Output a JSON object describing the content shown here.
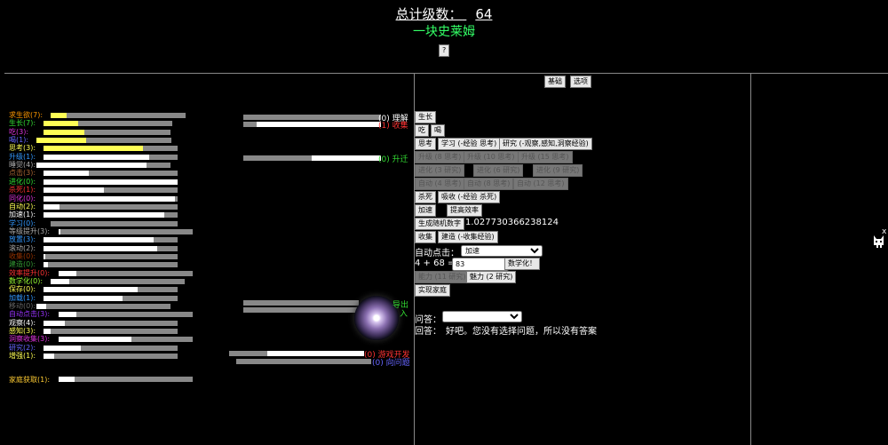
{
  "header": {
    "total_label": "总计级数：",
    "total_value": "64",
    "creature_name": "一块史莱姆",
    "help_label": "?"
  },
  "colors": {
    "yellow": "#ffff55",
    "white": "#ffffff",
    "gray": "#888888"
  },
  "stats": [
    {
      "label": "求生欲(7):",
      "color": "#ff9900",
      "progress": 0.12,
      "fill": "#ffff55"
    },
    {
      "label": "生长(7):",
      "color": "#33dd33",
      "progress": 0.27,
      "fill": "#ffff55"
    },
    {
      "label": "吃(3):",
      "color": "#dd33dd",
      "progress": 0.32,
      "fill": "#ffff55"
    },
    {
      "label": "喝(1):",
      "color": "#6666ff",
      "progress": 0.37,
      "fill": "#ffff55"
    },
    {
      "label": "思考(3):",
      "color": "#ffff55",
      "progress": 0.74,
      "fill": "#ffff55"
    },
    {
      "label": "升级(1):",
      "color": "#3399ff",
      "progress": 0.79,
      "fill": "#ffffff"
    },
    {
      "label": "睡觉(4):",
      "color": "#aaaaaa",
      "progress": 0.82,
      "fill": "#ffffff"
    },
    {
      "label": "点击(3):",
      "color": "#aa6633",
      "progress": 0.34,
      "fill": "#ffffff"
    },
    {
      "label": "进化(0):",
      "color": "#33dd33",
      "progress": 1.0,
      "fill": "#ffffff"
    },
    {
      "label": "杀死(1):",
      "color": "#ff3333",
      "progress": 0.45,
      "fill": "#ffffff"
    },
    {
      "label": "同化(0):",
      "color": "#dd33dd",
      "progress": 0.98,
      "fill": "#ffffff"
    },
    {
      "label": "自动(2):",
      "color": "#ffff55",
      "progress": 0.12,
      "fill": "#ffffff"
    },
    {
      "label": "加速(1):",
      "color": "#ffffff",
      "progress": 0.9,
      "fill": "#ffffff"
    },
    {
      "label": "学习(0):",
      "color": "#3399ff",
      "progress": 0.3,
      "fill": "#888888"
    },
    {
      "label": "等级提升(3):",
      "color": "#aaaaaa",
      "progress": 0.01,
      "fill": "#ffffff"
    },
    {
      "label": "放置(3):",
      "color": "#3399ff",
      "progress": 0.82,
      "fill": "#ffffff"
    },
    {
      "label": "滚动(2):",
      "color": "#aaaaaa",
      "progress": 0.85,
      "fill": "#ffffff"
    },
    {
      "label": "收集(0):",
      "color": "#993300",
      "progress": 0.01,
      "fill": "#ffffff"
    },
    {
      "label": "建造(0):",
      "color": "#339933",
      "progress": 0.03,
      "fill": "#ffffff"
    },
    {
      "label": "效率提升(0):",
      "color": "#ff3333",
      "progress": 0.13,
      "fill": "#ffffff"
    },
    {
      "label": "数学化(0):",
      "color": "#99ff33",
      "progress": 0.14,
      "fill": "#ffffff"
    },
    {
      "label": "保存(0):",
      "color": "#ffff55",
      "progress": 0.7,
      "fill": "#ffffff"
    },
    {
      "label": "加载(1):",
      "color": "#3399ff",
      "progress": 0.59,
      "fill": "#ffffff"
    },
    {
      "label": "移动(0):",
      "color": "#666666",
      "progress": 0.07,
      "fill": "#ffffff"
    },
    {
      "label": "自动点击(3):",
      "color": "#9933ff",
      "progress": 0.13,
      "fill": "#ffffff"
    },
    {
      "label": "观察(4):",
      "color": "#ffffff",
      "progress": 0.16,
      "fill": "#ffffff"
    },
    {
      "label": "感知(3):",
      "color": "#ffff55",
      "progress": 0.05,
      "fill": "#ffffff"
    },
    {
      "label": "洞察收集(3):",
      "color": "#dd33dd",
      "progress": 0.54,
      "fill": "#ffffff"
    },
    {
      "label": "研究(2):",
      "color": "#6666ff",
      "progress": 0.28,
      "fill": "#ffffff"
    },
    {
      "label": "增强(1):",
      "color": "#ffff55",
      "progress": 0.08,
      "fill": "#ffffff"
    }
  ],
  "family": {
    "label": "家庭获取(1):",
    "color": "#ffcc33",
    "progress": 0.12
  },
  "resources": [
    {
      "label": "(0) 理解",
      "color": "#ffffff",
      "progress": 0.0,
      "fill": "#ffffff"
    },
    {
      "label": "(1) 收集",
      "color": "#ff3333",
      "progress": 0.9,
      "fill": "#ffffff"
    },
    {
      "label": "(0) 升迁",
      "color": "#33dd33",
      "progress": 0.5,
      "fill": "#ffffff"
    }
  ],
  "export_label": "导出",
  "import_label": "入",
  "dev_resources": [
    {
      "label": "(0) 游戏开发",
      "color": "#ff3333",
      "progress": 0.72,
      "fill": "#ffffff"
    },
    {
      "label": "(0) 向问题",
      "color": "#6666ff",
      "progress": 0.0,
      "fill": "#ffffff"
    }
  ],
  "tabs": {
    "basic": "基础",
    "options": "选项"
  },
  "actions": {
    "grow": "生长",
    "eat": "吃",
    "drink": "喝",
    "think": "思考",
    "learn": "学习 (-经验 思考)",
    "research": "研究 (-观察,感知,洞察经验)",
    "upgrade1": "升级 (8 思考)",
    "upgrade2": "升级 (10 思考)",
    "upgrade3": "升级 (15 思考)",
    "evolve1": "进化 (3 研究)",
    "evolve2": "进化 (6 研究)",
    "evolve3": "进化 (9 研究)",
    "auto1": "自动 (4 思考)",
    "auto2": "自动 (8 思考)",
    "auto3": "自动 (12 思考)",
    "kill": "杀死",
    "absorb": "吸收 (-经验 杀死)",
    "speed": "加速",
    "improve": "提高效率",
    "gen_random": "生成随机数字",
    "random_value": "1.027730366238124",
    "collect": "收集",
    "build": "建造 (-收集经验)",
    "autoclick_label": "自动点击：",
    "autoclick_selected": "加速",
    "math_question": "4 + 68 =",
    "math_input": "83",
    "math_button": "数学化！",
    "power": "能力 (11 研究)",
    "charm": "魅力 (2 研究)",
    "family": "实现家庭"
  },
  "qa": {
    "question_label": "问答：",
    "question_selected": "",
    "answer_label": "回答：",
    "answer_text": "好吧。您没有选择问题，所以没有答案"
  },
  "side": {
    "close": "x"
  }
}
